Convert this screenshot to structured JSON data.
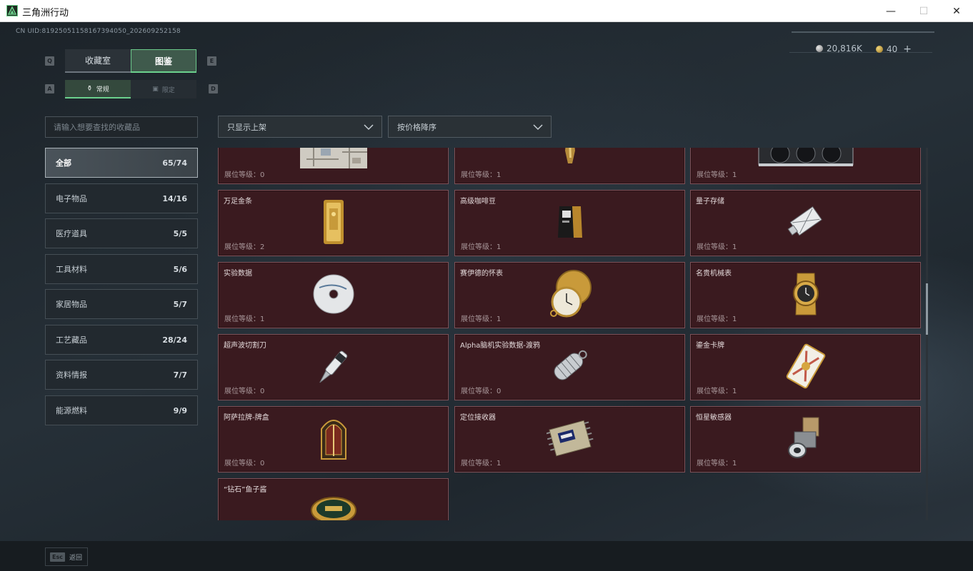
{
  "window": {
    "title": "三角洲行动",
    "minimize": "—",
    "maximize": "☐",
    "close": "✕"
  },
  "uid": "CN UID:8192505115816739405​0_202609252158",
  "currency": {
    "coins": "20,816K",
    "tokens": "40",
    "add": "+"
  },
  "tabs": {
    "key_left": "Q",
    "key_right": "E",
    "items": [
      {
        "label": "收藏室"
      },
      {
        "label": "图鉴"
      }
    ]
  },
  "subtabs": {
    "key_left": "A",
    "key_right": "D",
    "items": [
      {
        "label": "常规"
      },
      {
        "label": "限定"
      }
    ]
  },
  "search": {
    "placeholder": "请输入想要查找的收藏品"
  },
  "filters": {
    "shelf": "只显示上架",
    "sort": "按价格降序"
  },
  "categories": [
    {
      "label": "全部",
      "count": "65/74"
    },
    {
      "label": "电子物品",
      "count": "14/16"
    },
    {
      "label": "医疗道具",
      "count": "5/5"
    },
    {
      "label": "工具材料",
      "count": "5/6"
    },
    {
      "label": "家居物品",
      "count": "5/7"
    },
    {
      "label": "工艺藏品",
      "count": "28/24"
    },
    {
      "label": "资料情报",
      "count": "7/7"
    },
    {
      "label": "能源燃料",
      "count": "9/9"
    }
  ],
  "level_prefix": "展位等级：",
  "items": [
    {
      "name": "",
      "level": "展位等级：0",
      "icon": "map-icon"
    },
    {
      "name": "",
      "level": "展位等级：1",
      "icon": "trophy-icon"
    },
    {
      "name": "",
      "level": "展位等级：1",
      "icon": "gpu-icon"
    },
    {
      "name": "万足金条",
      "level": "展位等级：2",
      "icon": "gold-bar-icon"
    },
    {
      "name": "高级咖啡豆",
      "level": "展位等级：1",
      "icon": "coffee-bag-icon"
    },
    {
      "name": "量子存储",
      "level": "展位等级：1",
      "icon": "usb-drive-icon"
    },
    {
      "name": "实验数据",
      "level": "展位等级：1",
      "icon": "disc-icon"
    },
    {
      "name": "赛伊德的怀表",
      "level": "展位等级：1",
      "icon": "pocket-watch-icon"
    },
    {
      "name": "名贵机械表",
      "level": "展位等级：1",
      "icon": "wristwatch-icon"
    },
    {
      "name": "超声波切割刀",
      "level": "展位等级：0",
      "icon": "knife-icon"
    },
    {
      "name": "Alpha脑机实验数据-渡鸦",
      "level": "展位等级：0",
      "icon": "data-capsule-icon"
    },
    {
      "name": "鎏金卡牌",
      "level": "展位等级：1",
      "icon": "card-icon"
    },
    {
      "name": "阿萨拉牌-牌盒",
      "level": "展位等级：0",
      "icon": "card-box-icon"
    },
    {
      "name": "定位接收器",
      "level": "展位等级：1",
      "icon": "receiver-icon"
    },
    {
      "name": "恒星敏感器",
      "level": "展位等级：1",
      "icon": "star-sensor-icon"
    },
    {
      "name": "“钻石”鱼子酱",
      "level": "",
      "icon": "caviar-tin-icon"
    }
  ],
  "footer": {
    "key": "Esc",
    "label": "返回"
  },
  "colors": {
    "accent": "#6bd18d",
    "card_bg": "#3a1a1f",
    "card_border": "#7f5158"
  }
}
